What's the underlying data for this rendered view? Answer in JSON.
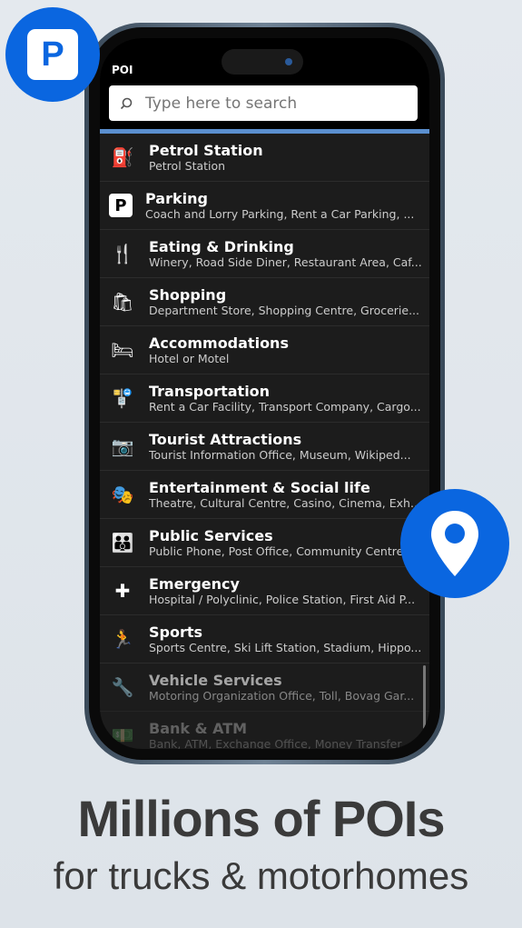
{
  "header": {
    "title": "POI"
  },
  "search": {
    "placeholder": "Type here to search"
  },
  "items": [
    {
      "icon": "fuel-pump-icon",
      "glyph": "⛽",
      "title": "Petrol Station",
      "subtitle": "Petrol Station"
    },
    {
      "icon": "parking-icon",
      "glyph": "P",
      "title": "Parking",
      "subtitle": "Coach and Lorry Parking, Rent a Car Parking, ..."
    },
    {
      "icon": "fork-knife-icon",
      "glyph": "🍴",
      "title": "Eating & Drinking",
      "subtitle": "Winery, Road Side Diner, Restaurant Area, Caf..."
    },
    {
      "icon": "shopping-bag-icon",
      "glyph": "🛍",
      "title": "Shopping",
      "subtitle": "Department Store, Shopping Centre, Grocerie..."
    },
    {
      "icon": "bed-icon",
      "glyph": "🛏",
      "title": "Accommodations",
      "subtitle": "Hotel or Motel"
    },
    {
      "icon": "bus-stop-icon",
      "glyph": "🚏",
      "title": "Transportation",
      "subtitle": "Rent a Car Facility, Transport Company, Cargo..."
    },
    {
      "icon": "camera-icon",
      "glyph": "📷",
      "title": "Tourist Attractions",
      "subtitle": "Tourist Information Office, Museum, Wikiped..."
    },
    {
      "icon": "theatre-masks-icon",
      "glyph": "🎭",
      "title": "Entertainment & Social life",
      "subtitle": "Theatre, Cultural Centre, Casino, Cinema, Exh..."
    },
    {
      "icon": "people-icon",
      "glyph": "👪",
      "title": "Public Services",
      "subtitle": "Public Phone, Post Office, Community Centre..."
    },
    {
      "icon": "medical-cross-icon",
      "glyph": "✚",
      "title": "Emergency",
      "subtitle": "Hospital / Polyclinic, Police Station, First Aid P..."
    },
    {
      "icon": "running-icon",
      "glyph": "🏃",
      "title": "Sports",
      "subtitle": "Sports Centre, Ski Lift Station, Stadium, Hippo..."
    },
    {
      "icon": "car-wrench-icon",
      "glyph": "🔧",
      "title": "Vehicle Services",
      "subtitle": "Motoring Organization Office, Toll, Bovag Gar..."
    },
    {
      "icon": "money-stack-icon",
      "glyph": "💵",
      "title": "Bank & ATM",
      "subtitle": "Bank, ATM, Exchange Office, Money Transfer..."
    }
  ],
  "badges": {
    "parking_letter": "P"
  },
  "headline": "Millions of POIs",
  "subheadline": "for trucks & motorhomes",
  "colors": {
    "accent": "#0a66e0",
    "list_bg": "#1c1c1c",
    "header_line": "#5b8fcf"
  }
}
